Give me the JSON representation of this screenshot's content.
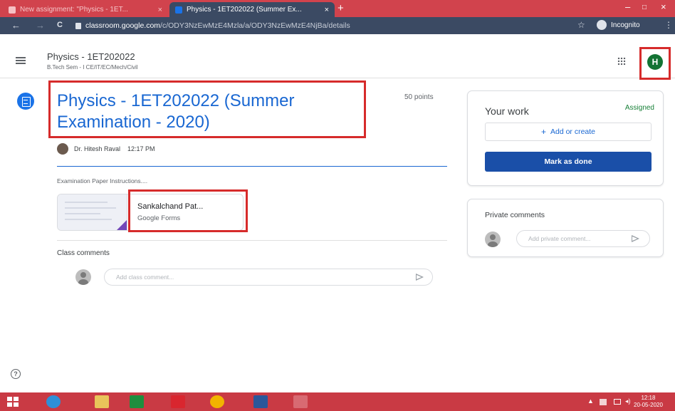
{
  "browser": {
    "tabs": [
      {
        "title": "New assignment: \"Physics - 1ET...",
        "active": false
      },
      {
        "title": "Physics - 1ET202022 (Summer Ex...",
        "active": true
      }
    ],
    "new_tab": "+",
    "tab_close": "×",
    "window_controls": {
      "minimize": "–",
      "maximize": "□",
      "close": "×"
    },
    "nav": {
      "back": "←",
      "forward": "→",
      "reload": "C"
    },
    "url_host": "classroom.google.com",
    "url_path": "/c/ODY3NzEwMzE4Mzla/a/ODY3NzEwMzE4NjBa/details",
    "star": "☆",
    "incognito_label": "Incognito",
    "menu": "⋮"
  },
  "header": {
    "class_title": "Physics - 1ET202022",
    "class_subtitle": "B.Tech Sem - I CE/IT/EC/Mech/Civil",
    "avatar_letter": "H"
  },
  "assignment": {
    "title": "Physics - 1ET202022 (Summer Examination - 2020)",
    "points": "50 points",
    "teacher": "Dr. Hitesh Raval",
    "time": "12:17 PM",
    "instructions": "Examination Paper Instructions....",
    "attachment": {
      "name": "Sankalchand Pat...",
      "type": "Google Forms"
    }
  },
  "class_comments": {
    "heading": "Class comments",
    "placeholder": "Add class comment..."
  },
  "your_work": {
    "title": "Your work",
    "status": "Assigned",
    "add_plus": "+",
    "add_label": "Add or create",
    "mark_done": "Mark as done"
  },
  "private_comments": {
    "title": "Private comments",
    "placeholder": "Add private comment..."
  },
  "help": "?",
  "taskbar": {
    "clock_time": "12:18",
    "clock_date": "20-05-2020",
    "tray_up": "▲",
    "volume": "◂)"
  },
  "colors": {
    "accent_blue": "#1967d2",
    "assigned_green": "#188038",
    "mark_done_bg": "#1a4fa8",
    "highlight_red": "#d62b2b",
    "chrome_red": "#d1434d",
    "incognito_toolbar": "#3b4a63"
  }
}
